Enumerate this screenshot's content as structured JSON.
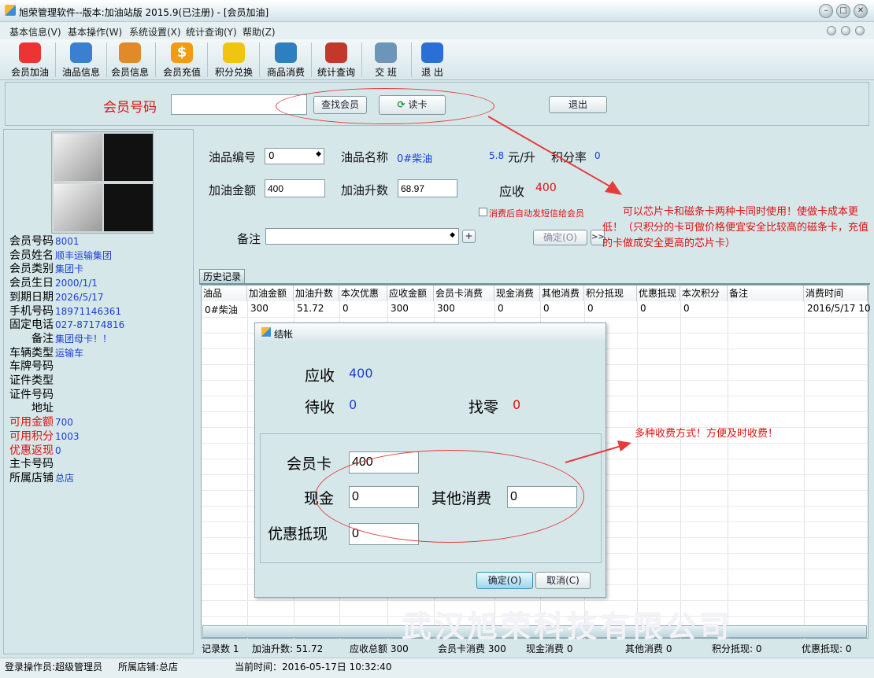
{
  "window": {
    "title": "旭荣管理软件--版本:加油站版 2015.9(已注册) - [会员加油]",
    "min": "–",
    "max": "□",
    "close": "✕"
  },
  "menu": [
    "基本信息(V)",
    "基本操作(W)",
    "系统设置(X)",
    "统计查询(Y)",
    "帮助(Z)"
  ],
  "toolbar": [
    {
      "label": "会员加油",
      "icon": "car-icon",
      "color": "#e33"
    },
    {
      "label": "油品信息",
      "icon": "fuel-icon",
      "color": "#3a7fd0"
    },
    {
      "label": "会员信息",
      "icon": "users-icon",
      "color": "#e08a2a"
    },
    {
      "label": "会员充值",
      "icon": "dollar-icon",
      "color": "#f39c12",
      "glyph": "$"
    },
    {
      "label": "积分兑换",
      "icon": "exchange-icon",
      "color": "#f1c40f"
    },
    {
      "label": "商品消费",
      "icon": "goods-icon",
      "color": "#2e7fbf"
    },
    {
      "label": "统计查询",
      "icon": "stats-icon",
      "color": "#c0392b"
    },
    {
      "label": "交 班",
      "icon": "handover-icon",
      "color": "#6c95b8"
    },
    {
      "label": "退 出",
      "icon": "exit-icon",
      "color": "#2a6fd6"
    }
  ],
  "search": {
    "label": "会员号码",
    "value": "",
    "find_label": "查找会员",
    "read_label": "读卡",
    "exit_label": "退出"
  },
  "member": {
    "rows": [
      {
        "label": "会员号码",
        "value": "8001",
        "red": false
      },
      {
        "label": "会员姓名",
        "value": "顺丰运输集团",
        "red": false
      },
      {
        "label": "会员类别",
        "value": "集团卡",
        "red": false
      },
      {
        "label": "会员生日",
        "value": "2000/1/1",
        "red": false
      },
      {
        "label": "到期日期",
        "value": "2026/5/17",
        "red": false
      },
      {
        "label": "手机号码",
        "value": "18971146361",
        "red": false
      },
      {
        "label": "固定电话",
        "value": "027-87174816",
        "red": false
      },
      {
        "label": "　　备注",
        "value": "集团母卡！！",
        "red": false
      },
      {
        "label": "车辆类型",
        "value": "运输车",
        "red": false
      },
      {
        "label": "车牌号码",
        "value": "",
        "red": false
      },
      {
        "label": "证件类型",
        "value": "",
        "red": false
      },
      {
        "label": "证件号码",
        "value": "",
        "red": false
      },
      {
        "label": "　　地址",
        "value": "",
        "red": false
      },
      {
        "label": "可用金额",
        "value": "700",
        "red": true
      },
      {
        "label": "可用积分",
        "value": "1003",
        "red": true
      },
      {
        "label": "优惠返现",
        "value": "0",
        "red": true
      },
      {
        "label": "主卡号码",
        "value": "",
        "red": false
      },
      {
        "label": "所属店铺",
        "value": "总店",
        "red": false
      }
    ]
  },
  "fuel": {
    "code_label": "油品编号",
    "code_value": "0",
    "name_label": "油品名称",
    "name_value": "0#柴油",
    "price": "5.8",
    "price_unit": "元/升",
    "rate_label": "积分率",
    "rate_value": "0",
    "amount_label": "加油金额",
    "amount_value": "400",
    "liters_label": "加油升数",
    "liters_value": "68.97",
    "due_label": "应收",
    "due_value": "400",
    "sms_label": "消费后自动发短信给会员",
    "note_label": "备注",
    "note_value": "",
    "confirm_label": "确定(O)",
    "more_label": ">>"
  },
  "history": {
    "tab": "历史记录",
    "headers": [
      "油品",
      "加油金额",
      "加油升数",
      "本次优惠",
      "应收金额",
      "会员卡消费",
      "现金消费",
      "其他消费",
      "积分抵现",
      "优惠抵现",
      "本次积分",
      "备注",
      "消费时间"
    ],
    "rows": [
      [
        "0#柴油",
        "300",
        "51.72",
        "0",
        "300",
        "300",
        "0",
        "0",
        "0",
        "0",
        "0",
        "",
        "2016/5/17 10"
      ]
    ],
    "watermark": "武汉旭荣科技有限公司"
  },
  "summary": [
    "记录数 1",
    "加油升数: 51.72",
    "应收总额 300",
    "会员卡消费 300",
    "现金消费 0",
    "其他消费 0",
    "积分抵现: 0",
    "优惠抵现: 0"
  ],
  "dialog": {
    "title": "结帐",
    "due_label": "应收",
    "due_value": "400",
    "pending_label": "待收",
    "pending_value": "0",
    "change_label": "找零",
    "change_value": "0",
    "card_label": "会员卡",
    "card_value": "400",
    "cash_label": "现金",
    "cash_value": "0",
    "other_label": "其他消费",
    "other_value": "0",
    "discount_label": "优惠抵现",
    "discount_value": "0",
    "ok_label": "确定(O)",
    "cancel_label": "取消(C)"
  },
  "annotations": {
    "card_note": "　　可以芯片卡和磁条卡两种卡同时使用！使做卡成本更低！（只积分的卡可做价格便宜安全比较高的磁条卡，充值的卡做成安全更高的芯片卡）",
    "pay_note": "多种收费方式！方便及时收费！"
  },
  "status": {
    "operator": "登录操作员:超级管理员",
    "shop": "所属店铺:总店",
    "time": "当前时间：2016-05-17日 10:32:40"
  },
  "colors": {
    "accent_red": "#e01010",
    "value_blue": "#1a3fd8",
    "bg": "#d6e7ea"
  }
}
